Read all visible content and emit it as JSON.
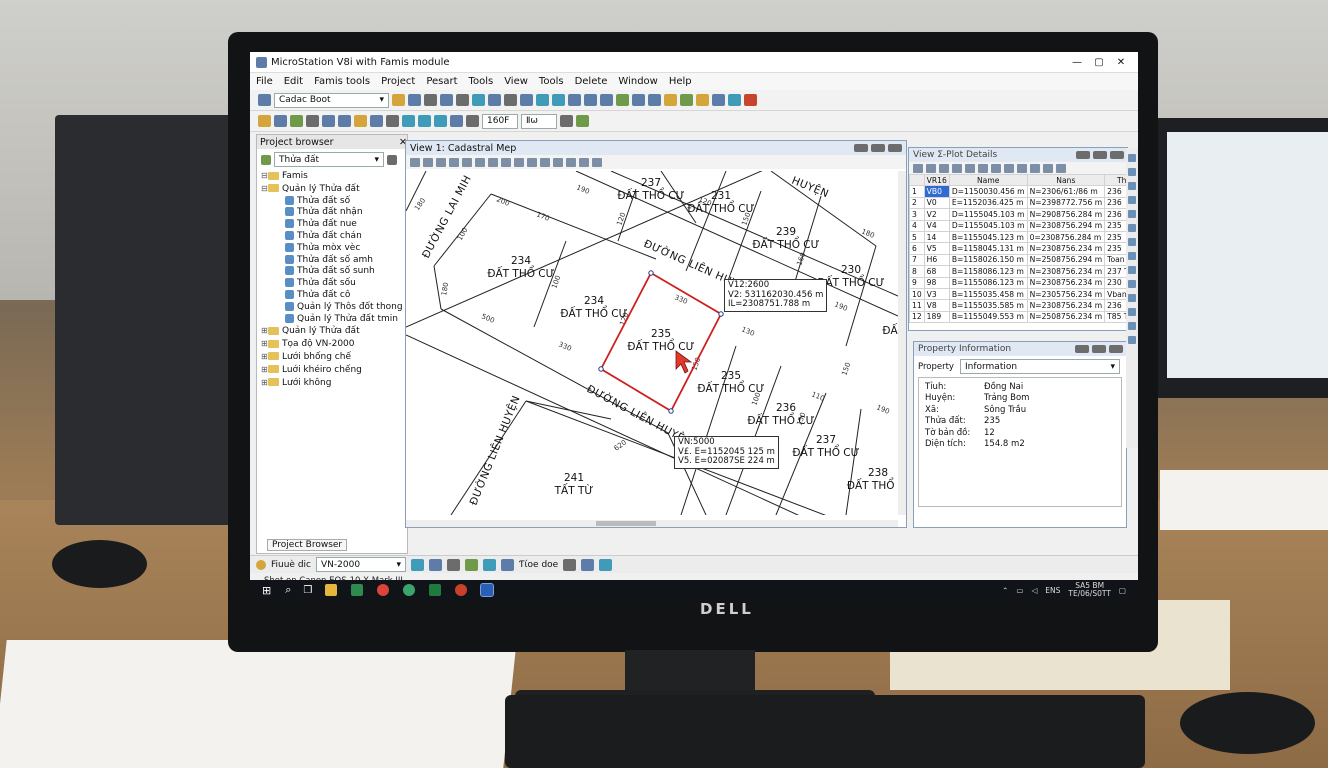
{
  "app": {
    "title": "MicroStation V8i with Famis module",
    "win_min": "—",
    "win_max": "▢",
    "win_close": "✕"
  },
  "menu": [
    "File",
    "Edit",
    "Famis tools",
    "Project",
    "Pesart",
    "Tools",
    "View",
    "Tools",
    "Delete",
    "Window",
    "Help"
  ],
  "toolbar": {
    "model_combo": "Cadac Boot",
    "scale_combo": "160F",
    "unit_combo": "Ⅱω"
  },
  "project_browser": {
    "title": "Project browser",
    "header_close": "✕",
    "filter_value": "Thửa đất",
    "tab_label": "Project Browser",
    "tree": [
      {
        "label": "Famis",
        "level": 0,
        "kind": "folder",
        "expander": "⊟"
      },
      {
        "label": "Quản lý Thửa đất",
        "level": 0,
        "kind": "folder",
        "expander": "⊟"
      },
      {
        "label": "Thửa đất số",
        "level": 1,
        "kind": "layer"
      },
      {
        "label": "Thửa đất nhận",
        "level": 1,
        "kind": "layer"
      },
      {
        "label": "Thửa đất nue",
        "level": 1,
        "kind": "layer"
      },
      {
        "label": "Thửa đất chán",
        "level": 1,
        "kind": "layer"
      },
      {
        "label": "Thửa mòx vèc",
        "level": 1,
        "kind": "layer"
      },
      {
        "label": "Thửa đất số amh",
        "level": 1,
        "kind": "layer"
      },
      {
        "label": "Thửa đất số sunh",
        "level": 1,
        "kind": "layer"
      },
      {
        "label": "Thửa đất sốu",
        "level": 1,
        "kind": "layer"
      },
      {
        "label": "Thửa đất cô",
        "level": 1,
        "kind": "layer"
      },
      {
        "label": "Quản lý Thôs đốt thong",
        "level": 1,
        "kind": "layer"
      },
      {
        "label": "Quản lý Thửa đất tmin",
        "level": 1,
        "kind": "layer"
      },
      {
        "label": "Quản lý Thửa đất",
        "level": 0,
        "kind": "folder",
        "expander": "⊞"
      },
      {
        "label": "Tọa độ VN-2000",
        "level": 0,
        "kind": "folder",
        "expander": "⊞"
      },
      {
        "label": "Lưới bhống chế",
        "level": 0,
        "kind": "folder",
        "expander": "⊞"
      },
      {
        "label": "Luới khéiro chếng",
        "level": 0,
        "kind": "folder",
        "expander": "⊞"
      },
      {
        "label": "Lưới không",
        "level": 0,
        "kind": "folder",
        "expander": "⊞"
      }
    ]
  },
  "view": {
    "title": "View 1: Cadastral Mep",
    "roads": [
      "ĐƯỜNG LIÊN HUYỆN",
      "ĐƯỜNG LIÊN HUYỆN",
      "ĐƯỜNG LIÊN HUYỆN",
      "ĐƯỜNG LAI MIH",
      "HUYỆN"
    ],
    "parcels": [
      {
        "num": "237",
        "use": "ĐẤT THỔ CƯ"
      },
      {
        "num": "231",
        "use": "ĐẤT THỔ CƯ"
      },
      {
        "num": "239",
        "use": "ĐẤT THỔ CƯ"
      },
      {
        "num": "230",
        "use": "ĐẤT THỔ CƯ"
      },
      {
        "num": "234",
        "use": "ĐẤT THỔ CƯ"
      },
      {
        "num": "234",
        "use": "ĐẤT THỔ CƯ"
      },
      {
        "num": "235",
        "use": "ĐẤT THỔ CƯ"
      },
      {
        "num": "235",
        "use": "ĐẤT THỔ CƯ"
      },
      {
        "num": "236",
        "use": "ĐẤT THỔ CƯ"
      },
      {
        "num": "237",
        "use": "ĐẤT THỔ CƯ"
      },
      {
        "num": "238",
        "use": "ĐẤT THỔ C"
      },
      {
        "num": "241",
        "use": "TẤT TỪ"
      },
      {
        "num": "",
        "use": "ĐẤ"
      }
    ],
    "dims": [
      "180",
      "200",
      "170",
      "190",
      "100",
      "180",
      "100",
      "120",
      "500",
      "330",
      "120",
      "130",
      "330",
      "620",
      "150",
      "160",
      "190",
      "180",
      "100",
      "150",
      "110",
      "190",
      "120",
      "150",
      "150",
      "190"
    ],
    "callout_top": [
      "V12:2600",
      "V2: 531162030.456 m",
      "IL=2308751.788 m"
    ],
    "callout_bottom": [
      "VN:5000",
      "V£. E=1152045 125 m",
      "V5. E=02087SE 224 m"
    ]
  },
  "vertex_panel": {
    "title": "View Σ-Plot Details",
    "columns": [
      "",
      "VR16",
      "Name",
      "Nans",
      "Thể đ"
    ],
    "rows": [
      [
        "1",
        "VB0",
        "D=1150030.456 m",
        "N=2306/61:/86 m",
        "236"
      ],
      [
        "2",
        "V0",
        "E=1152036.425 m",
        "N=2398772.756 m",
        "236"
      ],
      [
        "3",
        "V2",
        "D=1155045.103 m",
        "N=2908756.284 m",
        "236"
      ],
      [
        "4",
        "V4",
        "D=1155045.103 m",
        "N=2308756.294 m",
        "235"
      ],
      [
        "5",
        "14",
        "B=1155045.123 m",
        "0=2308756.284 m",
        "235"
      ],
      [
        "6",
        "V5",
        "B=1158045.131 m",
        "N=2308756.234 m",
        "235"
      ],
      [
        "7",
        "H6",
        "B=1158026.150 m",
        "N=2508756.294 m",
        "Toan trtổ 2"
      ],
      [
        "8",
        "68",
        "B=1158086.123 m",
        "N=2308756.234 m",
        "237 THỔ C"
      ],
      [
        "9",
        "98",
        "B=1155086.123 m",
        "N=2308756.234 m",
        "230"
      ],
      [
        "10",
        "V3",
        "B=1155035.458 m",
        "N=2305756.234 m",
        "Vban oabc"
      ],
      [
        "11",
        "V8",
        "B=1155035.585 m",
        "N=2308756.234 m",
        "236"
      ],
      [
        "12",
        "189",
        "B=1155049.553 m",
        "N=2508756.234 m",
        "T85 THổ c"
      ]
    ]
  },
  "property": {
    "title": "Property Information",
    "label": "Property",
    "combo": "Information",
    "fields": [
      {
        "k": "Tỉuh:",
        "v": "Đồng Nai"
      },
      {
        "k": "Huyện:",
        "v": "Trảng Bom"
      },
      {
        "k": "Xã:",
        "v": "Sông Trầu"
      },
      {
        "k": "Thửa đất:",
        "v": "235"
      },
      {
        "k": "Tờ bản đồ:",
        "v": "12"
      },
      {
        "k": "Diện tích:",
        "v": "154.8 m2"
      }
    ]
  },
  "status": {
    "left_label": "Fiuuè dic",
    "crs": "VN-2000",
    "mid": "Ƭίοe dοe"
  },
  "caption": "Shot on Canon EOS-10 X Mark III",
  "tray": {
    "lang": "ENS",
    "time": "SA5 BM",
    "date": "TE/06/S0TT"
  },
  "brand": "DELL",
  "colors": {
    "selection": "#2f6bd3",
    "parcel_highlight": "#d01f1f",
    "cursor": "#e23a2a",
    "taskbar": "#101418"
  }
}
